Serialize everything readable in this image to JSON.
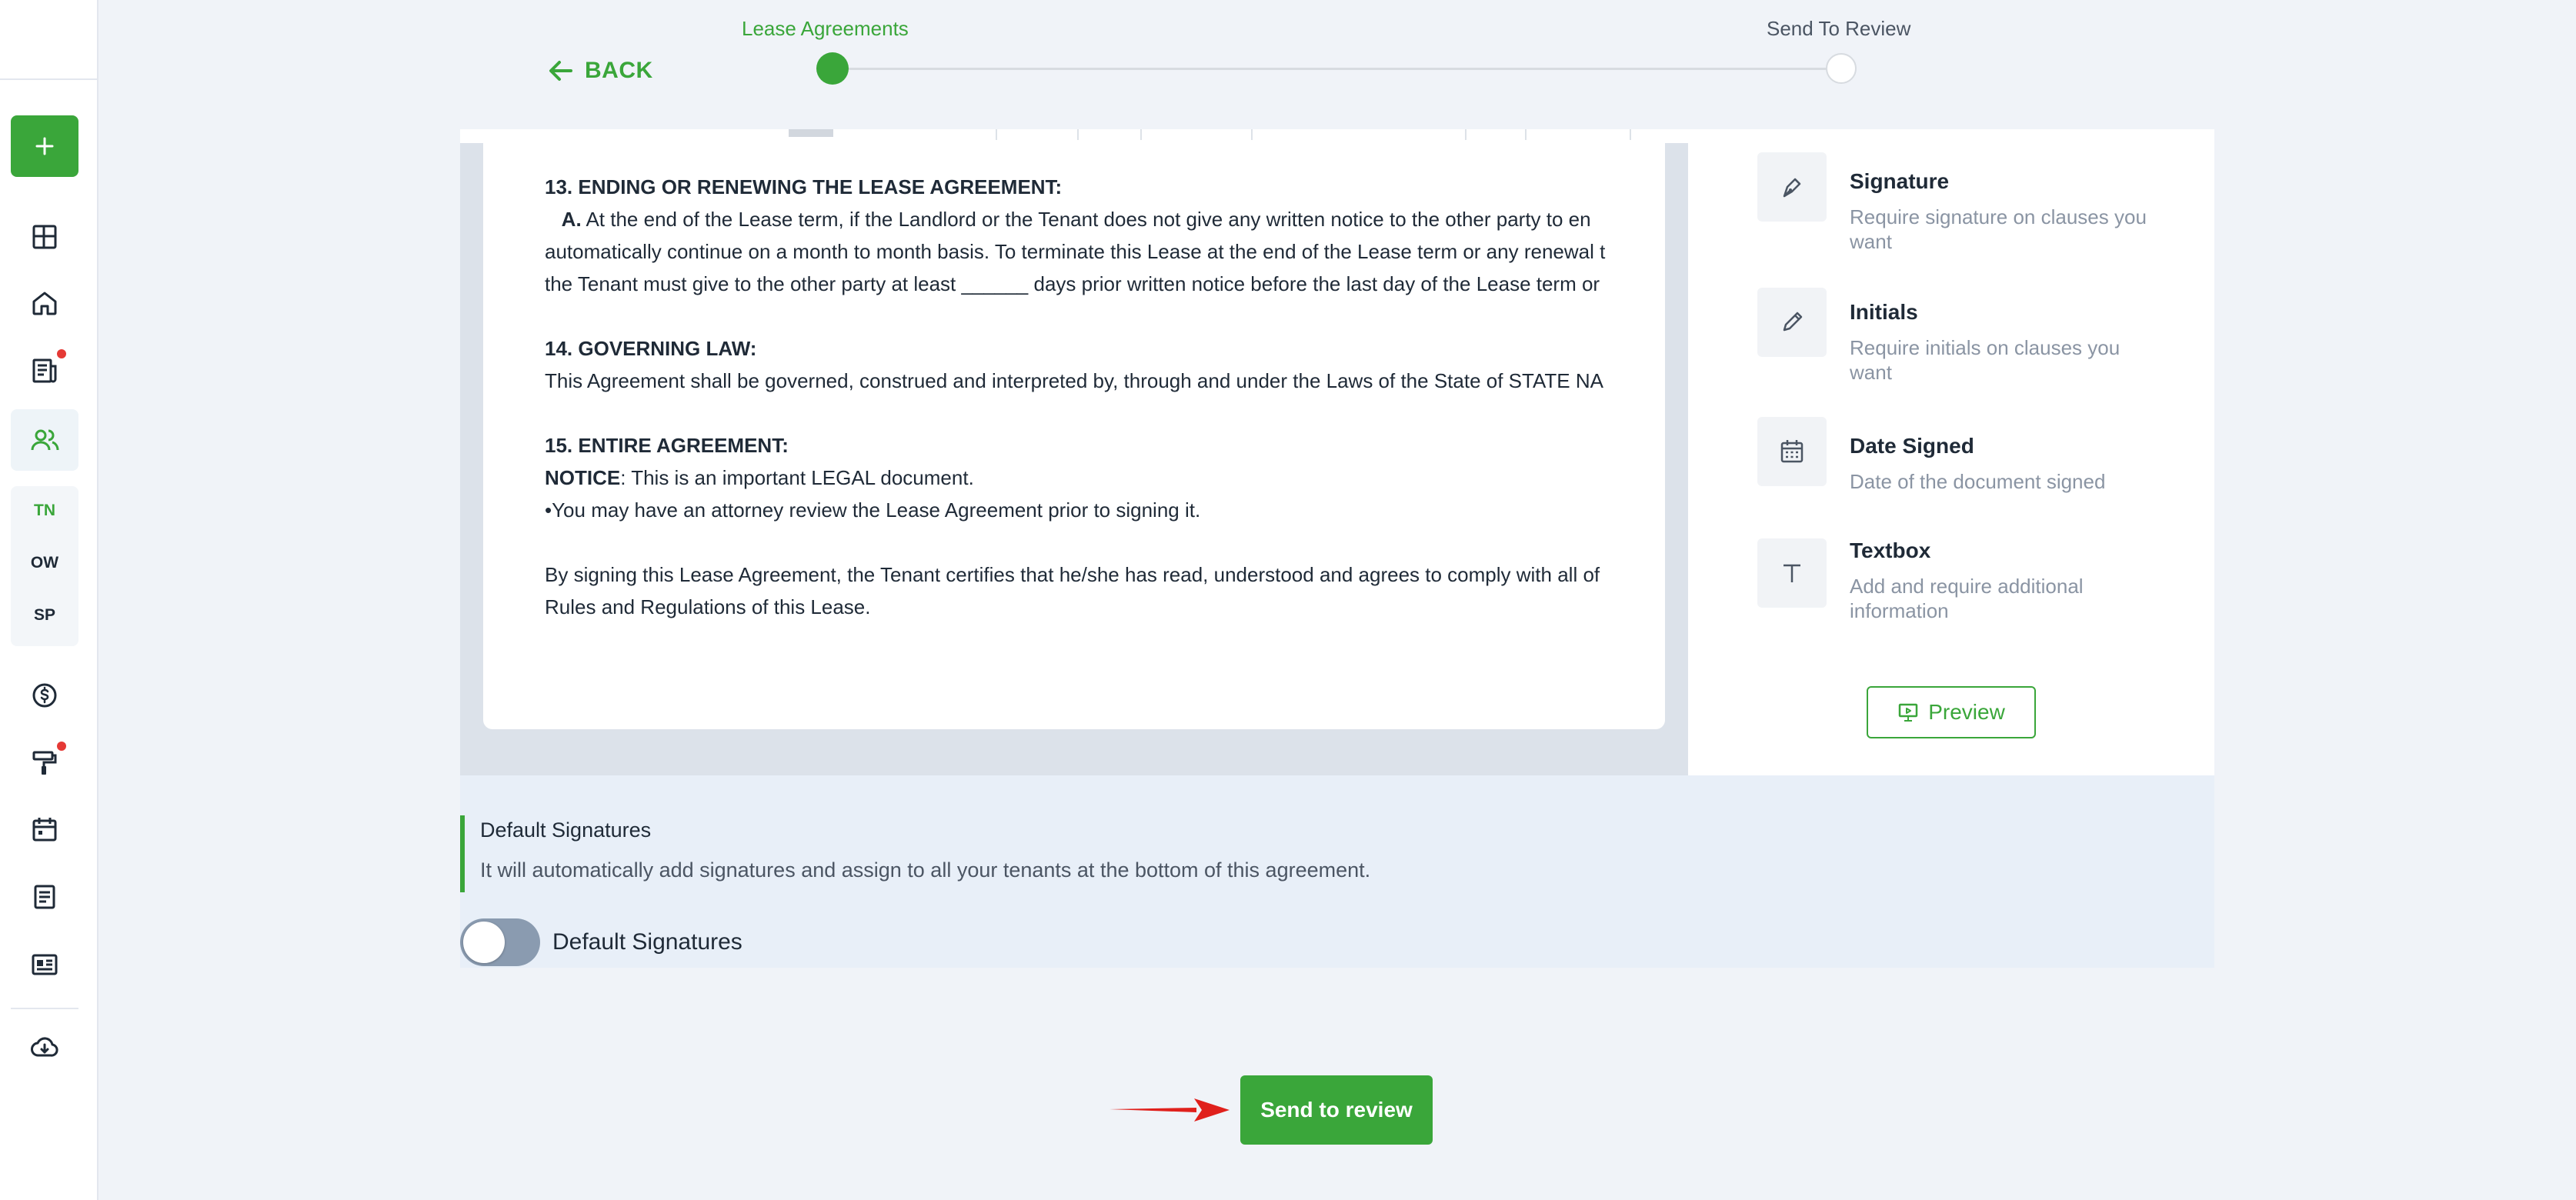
{
  "stepper": {
    "back_label": "BACK",
    "step1_label": "Lease Agreements",
    "step2_label": "Send To Review"
  },
  "sidebar": {
    "sub_items": [
      "TN",
      "OW",
      "SP"
    ]
  },
  "document": {
    "section13_title": "13. ENDING OR RENEWING THE LEASE AGREEMENT:",
    "section13_a_label": "A.",
    "section13_line1": " At the end of the Lease term, if the Landlord or the Tenant does not give any written notice to the other party to en",
    "section13_line2": "automatically continue on a month to month basis. To terminate this Lease at the end of the Lease term or any renewal t",
    "section13_line3": "the Tenant must give to the other party at least ______ days prior written notice before the last day of the Lease term or",
    "section14_title": "14. GOVERNING LAW:",
    "section14_line1": "This Agreement shall be governed, construed and interpreted by, through and under the Laws of the State of STATE NA",
    "section15_title": "15. ENTIRE AGREEMENT:",
    "notice_label": "NOTICE",
    "notice_text": ": This is an important LEGAL document.",
    "bullet_text": "•You may have an attorney review the Lease Agreement prior to signing it.",
    "closing_line1": "By signing this Lease Agreement, the Tenant certifies that he/she has read, understood and agrees to comply with all of",
    "closing_line2": "Rules and Regulations of this Lease."
  },
  "fields": [
    {
      "title": "Signature",
      "desc": "Require signature on clauses you want",
      "icon": "signature-pen-icon"
    },
    {
      "title": "Initials",
      "desc": "Require initials on clauses you want",
      "icon": "pencil-icon"
    },
    {
      "title": "Date Signed",
      "desc": "Date of the document signed",
      "icon": "calendar-icon"
    },
    {
      "title": "Textbox",
      "desc": "Add and require additional information",
      "icon": "text-icon"
    }
  ],
  "preview_label": "Preview",
  "default_signatures": {
    "title": "Default Signatures",
    "description": "It will automatically add signatures and assign to all your tenants at the bottom of this agreement.",
    "toggle_label": "Default Signatures",
    "enabled": false
  },
  "send_button_label": "Send to review",
  "colors": {
    "accent": "#3aa63a",
    "arrow": "#e0201c"
  }
}
